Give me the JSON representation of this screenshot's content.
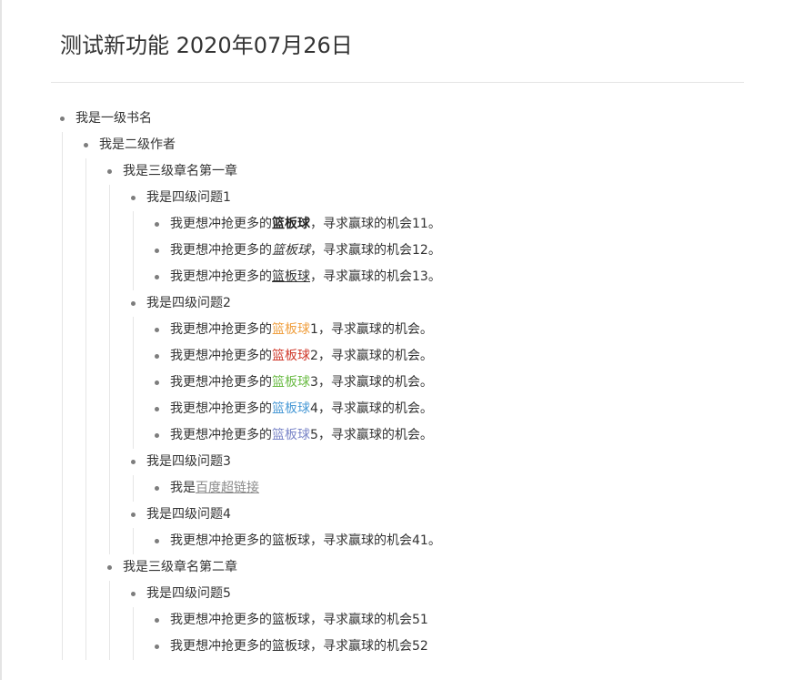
{
  "doc": {
    "title": "测试新功能 2020年07月26日"
  },
  "outline": {
    "l1": "我是一级书名",
    "l2": "我是二级作者",
    "ch1": {
      "label": "我是三级章名第一章",
      "q1": {
        "label": "我是四级问题1",
        "items": [
          {
            "pre": "我更想冲抢更多的",
            "kw": "篮板球",
            "post": "，寻求赢球的机会11。",
            "style": "bold"
          },
          {
            "pre": "我更想冲抢更多的",
            "kw": "篮板球",
            "post": "，寻求赢球的机会12。",
            "style": "italic"
          },
          {
            "pre": "我更想冲抢更多的",
            "kw": "篮板球",
            "post": "，寻求赢球的机会13。",
            "style": "underline"
          }
        ]
      },
      "q2": {
        "label": "我是四级问题2",
        "items": [
          {
            "pre": "我更想冲抢更多的",
            "kw": "篮板球",
            "num": "1",
            "post": "，寻求赢球的机会。",
            "color": "#f0a040"
          },
          {
            "pre": "我更想冲抢更多的",
            "kw": "篮板球",
            "num": "2",
            "post": "，寻求赢球的机会。",
            "color": "#d03a2c"
          },
          {
            "pre": "我更想冲抢更多的",
            "kw": "篮板球",
            "num": "3",
            "post": "，寻求赢球的机会。",
            "color": "#6cbc46"
          },
          {
            "pre": "我更想冲抢更多的",
            "kw": "篮板球",
            "num": "4",
            "post": "，寻求赢球的机会。",
            "color": "#4a9ad6"
          },
          {
            "pre": "我更想冲抢更多的",
            "kw": "篮板球",
            "num": "5",
            "post": "，寻求赢球的机会。",
            "color": "#7b86c8"
          }
        ]
      },
      "q3": {
        "label": "我是四级问题3",
        "item_pre": "我是",
        "link_text": "百度超链接"
      },
      "q4": {
        "label": "我是四级问题4",
        "item": "我更想冲抢更多的篮板球，寻求赢球的机会41。"
      }
    },
    "ch2": {
      "label": "我是三级章名第二章",
      "q5": {
        "label": "我是四级问题5",
        "items": [
          "我更想冲抢更多的篮板球，寻求赢球的机会51",
          "我更想冲抢更多的篮板球，寻求赢球的机会52"
        ]
      }
    }
  }
}
